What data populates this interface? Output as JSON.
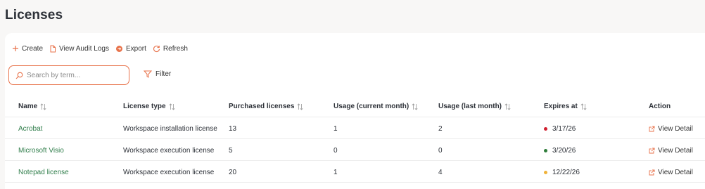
{
  "page": {
    "title": "Licenses"
  },
  "toolbar": {
    "create_label": "Create",
    "audit_label": "View Audit Logs",
    "export_label": "Export",
    "refresh_label": "Refresh"
  },
  "search": {
    "placeholder": "Search by term...",
    "value": ""
  },
  "filter": {
    "label": "Filter"
  },
  "table": {
    "headers": {
      "name": "Name",
      "license_type": "License type",
      "purchased": "Purchased licenses",
      "usage_current": "Usage (current month)",
      "usage_last": "Usage (last month)",
      "expires": "Expires at",
      "action": "Action"
    },
    "rows": [
      {
        "name": "Acrobat",
        "license_type": "Workspace installation license",
        "purchased": "13",
        "usage_current": "1",
        "usage_last": "2",
        "expires": "3/17/26",
        "status_color": "#d01f2f",
        "action": "View Detail"
      },
      {
        "name": "Microsoft Visio",
        "license_type": "Workspace execution license",
        "purchased": "5",
        "usage_current": "0",
        "usage_last": "0",
        "expires": "3/20/26",
        "status_color": "#2e7d3a",
        "action": "View Detail"
      },
      {
        "name": "Notepad license",
        "license_type": "Workspace execution license",
        "purchased": "20",
        "usage_current": "1",
        "usage_last": "4",
        "expires": "12/22/26",
        "status_color": "#f0b23a",
        "action": "View Detail"
      }
    ]
  },
  "colors": {
    "accent": "#e8724a",
    "link": "#2f7d4a"
  }
}
